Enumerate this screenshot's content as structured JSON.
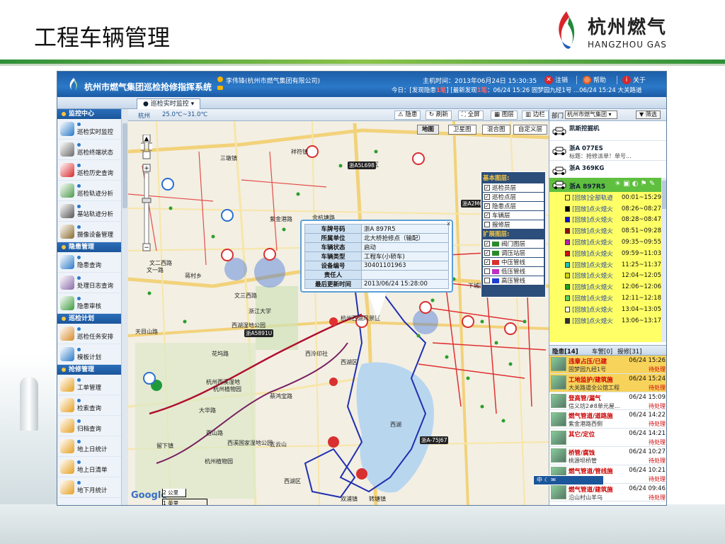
{
  "slide": {
    "title": "工程车辆管理",
    "logo_cn": "杭州燃气",
    "logo_en": "HANGZHOU GAS"
  },
  "header": {
    "system_title": "杭州市燃气集团巡检抢修指挥系统",
    "user": "李伟锋(杭州市燃气集团有限公司)",
    "host_time": "主机时间：2013年06月24日  15:30:35",
    "today_prefix": "今日：[发现隐患",
    "today_hazard_count": "1笔",
    "today_mid": "] [最新发现",
    "today_new_count": "1笔",
    "today_suffix": "：06/24 15:26 固梦园九经1号 ...06/24 15:24 大关路道",
    "logout": "注销",
    "help": "帮助",
    "about": "关于"
  },
  "tabs": {
    "active": "巡检实时监控"
  },
  "sidebar": {
    "sections": [
      {
        "title": "监控中心",
        "items": [
          "巡检实时监控",
          "巡检终端状态",
          "巡检历史查询",
          "巡检轨迹分析",
          "基站轨迹分析",
          "摄像设备管理"
        ]
      },
      {
        "title": "隐患管理",
        "items": [
          "隐患查询",
          "处理日志查询",
          "隐患审核"
        ]
      },
      {
        "title": "巡检计划",
        "items": [
          "巡检任务安排",
          "模板计划"
        ]
      },
      {
        "title": "抢修管理",
        "items": [
          "工单管理",
          "检索查询",
          "归档查询",
          "地上日统计",
          "地上日清单",
          "地下月统计"
        ]
      }
    ]
  },
  "map": {
    "city": "杭州",
    "weather": "25.0℃~31.0℃",
    "tool_hazard": "隐患",
    "tool_refresh": "刷新",
    "tool_fullscreen": "全屏",
    "tool_layers": "图层",
    "tool_side": "边栏",
    "type_map": "地图",
    "type_satellite": "卫星图",
    "type_hybrid": "混合图",
    "type_custom": "自定义层",
    "layers": {
      "basic_title": "基本图层:",
      "basic": [
        "巡检员层",
        "巡检点层",
        "隐患点层",
        "车辆层",
        "报修层"
      ],
      "ext_title": "扩展图层:",
      "ext": [
        {
          "label": "阀门图层",
          "color": "#2a8a2a"
        },
        {
          "label": "调压站层",
          "color": "#2a8a2a"
        },
        {
          "label": "中压管线",
          "color": "#d83030"
        },
        {
          "label": "低压管线",
          "color": "#c030c0"
        },
        {
          "label": "高压管线",
          "color": "#1f3fd0"
        }
      ]
    },
    "popup": {
      "rows": [
        {
          "k": "车牌号码",
          "v": "浙A 897R5"
        },
        {
          "k": "所属单位",
          "v": "北大桥抢修点（输配）"
        },
        {
          "k": "车辆状态",
          "v": "启动"
        },
        {
          "k": "车辆类型",
          "v": "工程车(小轿车)"
        },
        {
          "k": "设备编号",
          "v": "30401101963"
        },
        {
          "k": "责任人",
          "v": ""
        },
        {
          "k": "最后更新时间",
          "v": "2013/06/24 15:28:00"
        }
      ],
      "close": "x"
    },
    "labels": [
      "北城区",
      "拱墅区",
      "下城区",
      "西湖区",
      "杭州西溪湿地",
      "西湖",
      "三墩镇",
      "文二西路",
      "文一路",
      "天目山路",
      "杭州植物园",
      "蒋村乡",
      "祥符镇",
      "留下镇",
      "转塘镇",
      "大华路",
      "西湖区",
      "蔡鸿宝路",
      "杭州植物园",
      "西溪国家湿地公园",
      "浙江大学",
      "杭州西湖风景区",
      "西泠印社",
      "双浦镇",
      "紫金港路",
      "余杭塘路",
      "文三西路",
      "西湖湿地公园",
      "花坞路",
      "五云山",
      "西山路"
    ],
    "vehicles": [
      "浙A5L698",
      "浙A2M657",
      "浙AV715H",
      "浙A5891U",
      "浙A-75J67"
    ],
    "google": "Google",
    "scale_top": "2 公里",
    "scale_bottom": "1 英里"
  },
  "right": {
    "dept_label": "部门",
    "dept_value": "杭州市燃气集团",
    "filter": "筛选",
    "vehicles": [
      {
        "plate": "凯斯挖掘机",
        "sub": ""
      },
      {
        "plate": "浙A 077ES",
        "sub": "标题：抢修派单！单号..."
      },
      {
        "plate": "浙A 369KG",
        "sub": ""
      }
    ],
    "selected_plate": "浙A 897R5",
    "tracks": [
      {
        "name": "[回放]全部轨迹",
        "time": "00:01~15:29",
        "color": "#ffff66"
      },
      {
        "name": "[回放]点火熄火",
        "time": "08:26~08:27",
        "color": "#000000"
      },
      {
        "name": "[回放]点火熄火",
        "time": "08:28~08:47",
        "color": "#1010d0"
      },
      {
        "name": "[回放]点火熄火",
        "time": "08:51~09:28",
        "color": "#8a1010"
      },
      {
        "name": "[回放]点火熄火",
        "time": "09:35~09:55",
        "color": "#b020b0"
      },
      {
        "name": "[回放]点火熄火",
        "time": "09:59~11:03",
        "color": "#d01010"
      },
      {
        "name": "[回放]点火熄火",
        "time": "11:25~11:37",
        "color": "#20c0c0"
      },
      {
        "name": "[回放]点火熄火",
        "time": "12:04~12:05",
        "color": "#d0d010"
      },
      {
        "name": "[回放]点火熄火",
        "time": "12:06~12:06",
        "color": "#20a020"
      },
      {
        "name": "[回放]点火熄火",
        "time": "12:11~12:18",
        "color": "#60d060"
      },
      {
        "name": "[回放]点火熄火",
        "time": "13:04~13:05",
        "color": "#ffffff"
      },
      {
        "name": "[回放]点火熄火",
        "time": "13:06~13:17",
        "color": "#303030"
      }
    ],
    "alarm_tabs": [
      "隐患[14]",
      "车警[0]",
      "报修[31]"
    ],
    "alarms": [
      {
        "type": "违章占压/已建",
        "place": "固梦园九经1号",
        "time": "06/24 15:26",
        "status": "待处理",
        "hi": true
      },
      {
        "type": "工地监护/建筑施",
        "place": "大关路道全公馆工程",
        "time": "06/24 15:24",
        "status": "待处理",
        "hi": true
      },
      {
        "type": "登高管/漏气",
        "place": "信义坊2#8单元屋...",
        "time": "06/24 15:09",
        "status": "待处理",
        "hi": false
      },
      {
        "type": "燃气管道/道路施",
        "place": "紫金港路西侧",
        "time": "06/24 14:22",
        "status": "待处理",
        "hi": false
      },
      {
        "type": "其它/定位",
        "place": "",
        "time": "06/24 14:21",
        "status": "待处理",
        "hi": false
      },
      {
        "type": "桥管/腐蚀",
        "place": "桃源坝桥管",
        "time": "06/24 10:27",
        "status": "待处理",
        "hi": false
      },
      {
        "type": "燃气管道/管线施",
        "place": "沿山村山羊...",
        "time": "06/24 10:21",
        "status": "待处理",
        "hi": false
      },
      {
        "type": "燃气管道/建筑施",
        "place": "沿山村山羊乌",
        "time": "06/24 09:46",
        "status": "待处理",
        "hi": false
      }
    ],
    "media": "中 ☾ ✉"
  }
}
